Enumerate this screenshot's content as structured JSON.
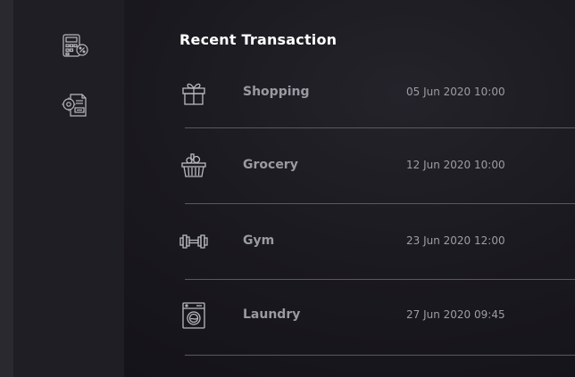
{
  "title": "Recent Transaction",
  "sidebar": {
    "items": [
      {
        "icon": "calculator-percent-icon"
      },
      {
        "icon": "settings-document-icon"
      }
    ]
  },
  "transactions": [
    {
      "name": "Shopping",
      "date": "05 Jun 2020 10:00",
      "icon": "gift-icon"
    },
    {
      "name": "Grocery",
      "date": "12 Jun 2020 10:00",
      "icon": "grocery-basket-icon"
    },
    {
      "name": "Gym",
      "date": "23 Jun 2020 12:00",
      "icon": "dumbbell-icon"
    },
    {
      "name": "Laundry",
      "date": "27 Jun 2020 09:45",
      "icon": "washing-machine-icon"
    }
  ],
  "colors": {
    "background": "#17161c",
    "sidebar": "#1f1e24",
    "title": "#ffffff",
    "text_muted": "#9a9aa2",
    "divider": "#5a5960",
    "icon": "#b9b9c0"
  }
}
